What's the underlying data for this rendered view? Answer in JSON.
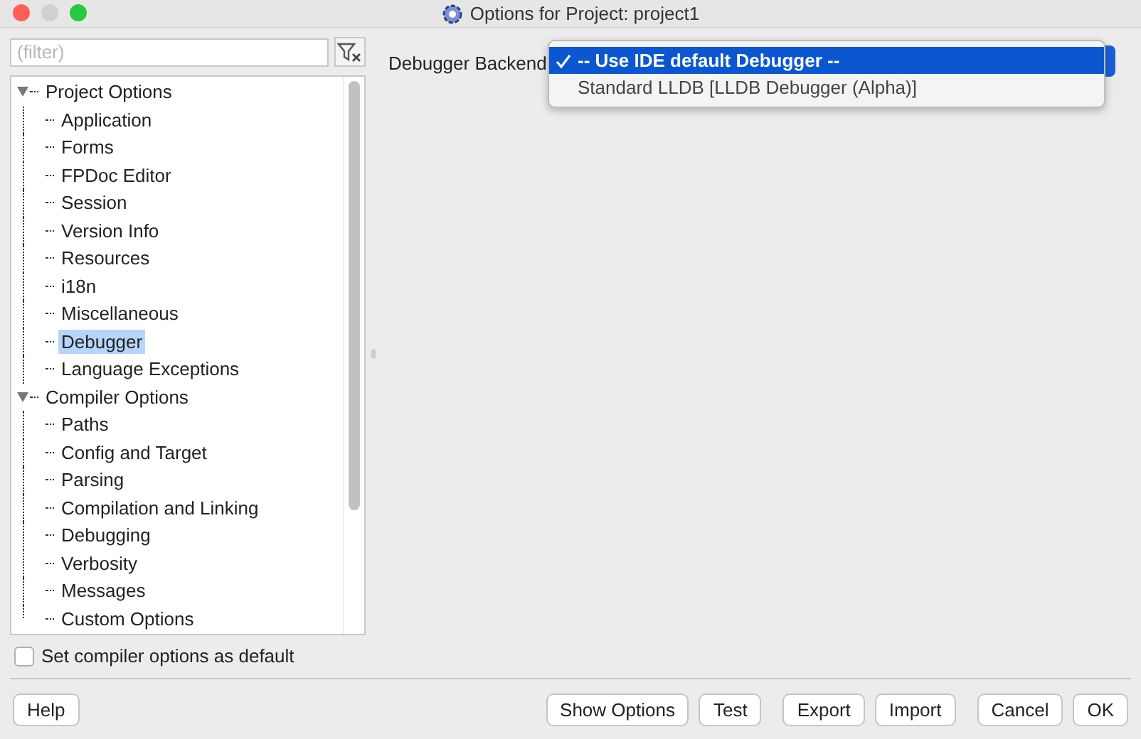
{
  "window": {
    "title": "Options for Project: project1"
  },
  "filter": {
    "placeholder": "(filter)"
  },
  "tree": [
    {
      "label": "Project Options",
      "expanded": true,
      "selected": false,
      "children": [
        {
          "label": "Application",
          "selected": false
        },
        {
          "label": "Forms",
          "selected": false
        },
        {
          "label": "FPDoc Editor",
          "selected": false
        },
        {
          "label": "Session",
          "selected": false
        },
        {
          "label": "Version Info",
          "selected": false
        },
        {
          "label": "Resources",
          "selected": false
        },
        {
          "label": "i18n",
          "selected": false
        },
        {
          "label": "Miscellaneous",
          "selected": false
        },
        {
          "label": "Debugger",
          "selected": true
        },
        {
          "label": "Language Exceptions",
          "selected": false
        }
      ]
    },
    {
      "label": "Compiler Options",
      "expanded": true,
      "selected": false,
      "children": [
        {
          "label": "Paths",
          "selected": false
        },
        {
          "label": "Config and Target",
          "selected": false
        },
        {
          "label": "Parsing",
          "selected": false
        },
        {
          "label": "Compilation and Linking",
          "selected": false
        },
        {
          "label": "Debugging",
          "selected": false
        },
        {
          "label": "Verbosity",
          "selected": false
        },
        {
          "label": "Messages",
          "selected": false
        },
        {
          "label": "Custom Options",
          "selected": false
        }
      ]
    }
  ],
  "default_checkbox": {
    "label": "Set compiler options as default",
    "checked": false
  },
  "debugger_backend": {
    "label": "Debugger Backend",
    "options": [
      {
        "label": "-- Use IDE default Debugger --",
        "selected": true
      },
      {
        "label": "Standard LLDB [LLDB Debugger (Alpha)]",
        "selected": false
      }
    ]
  },
  "button_groups": [
    [
      "Help"
    ],
    [
      "Show Options",
      "Test"
    ],
    [
      "Export",
      "Import"
    ],
    [
      "Cancel",
      "OK"
    ]
  ]
}
